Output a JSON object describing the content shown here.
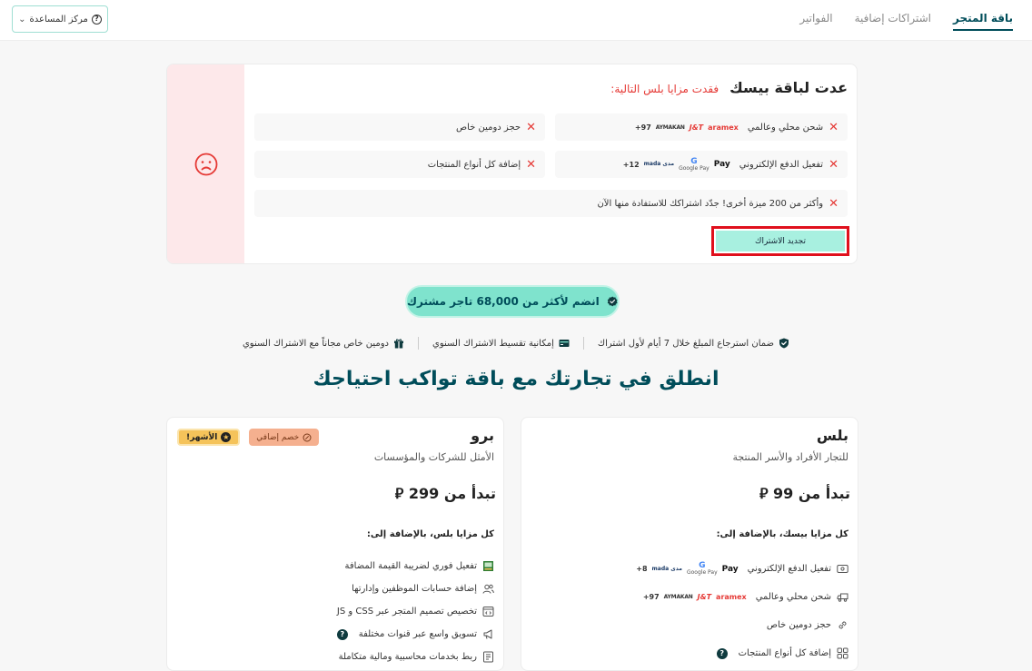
{
  "tabs": [
    {
      "label": "باقة المتجر"
    },
    {
      "label": "اشتراكات إضافية"
    },
    {
      "label": "الفواتير"
    }
  ],
  "help_center": {
    "label": "مركز المساعدة"
  },
  "downgrade": {
    "title": "عدت لباقة بيسك",
    "subtitle": "فقدت مزايا بلس التالية:",
    "items": [
      {
        "label": "شحن محلي وعالمي",
        "logos": [
          "aramex",
          "J&T",
          "AYMAKAN"
        ],
        "more": "97+"
      },
      {
        "label": "حجز دومين خاص"
      },
      {
        "label": "تفعيل الدفع الإلكتروني",
        "logos": [
          "Pay",
          "Google Pay",
          "مدى mada"
        ],
        "more": "12+"
      },
      {
        "label": "إضافة كل أنواع المنتجات"
      },
      {
        "label": "وأكثر من 200 ميزة أخرى! جدّد اشتراكك للاستفادة منها الآن"
      }
    ],
    "renew_label": "تجديد الاشتراك"
  },
  "join_label": "انضم لأكثر من 68,000 تاجر مشترك",
  "features": [
    {
      "label": "ضمان استرجاع المبلغ خلال 7 أيام لأول اشتراك"
    },
    {
      "label": "إمكانية تقسيط الاشتراك السنوي"
    },
    {
      "label": "دومين خاص مجاناً مع الاشتراك السنوي"
    }
  ],
  "headline": "انطلق في تجارتك مع باقة تواكب احتياجك",
  "plans": {
    "plus": {
      "name": "بلس",
      "desc": "للتجار الأفراد والأسر المنتجة",
      "price": "تبدأ من 99 ⃁",
      "includes": "كل مزايا بيسك، بالإضافة إلى:",
      "items": [
        {
          "label": "تفعيل الدفع الإلكتروني",
          "logos": [
            "Pay",
            "Google Pay",
            "مدى mada"
          ],
          "more": "8+"
        },
        {
          "label": "شحن محلي وعالمي",
          "logos": [
            "aramex",
            "J&T",
            "AYMAKAN"
          ],
          "more": "97+"
        },
        {
          "label": "حجز دومين خاص"
        },
        {
          "label": "إضافة كل أنواع المنتجات",
          "help": "?"
        }
      ]
    },
    "pro": {
      "name": "برو",
      "desc": "الأمثل للشركات والمؤسسات",
      "price": "تبدأ من 299 ⃁",
      "includes": "كل مزايا بلس، بالإضافة إلى:",
      "tag_popular": "الأشهر!",
      "tag_discount": "خصم إضافي",
      "items": [
        {
          "label": "تفعيل فوري لضريبة القيمة المضافة"
        },
        {
          "label": "إضافة حسابات الموظفين وإدارتها"
        },
        {
          "label": "تخصيص تصميم المتجر عبر CSS و JS"
        },
        {
          "label": "تسويق واسع عبر قنوات مختلفة",
          "help": "?"
        },
        {
          "label": "ربط بخدمات محاسبية ومالية متكاملة"
        }
      ]
    }
  },
  "colors": {
    "brand": "#004d5a",
    "accent": "#7fe3cd",
    "danger": "#e53935",
    "highlight_border": "#e0101d"
  }
}
